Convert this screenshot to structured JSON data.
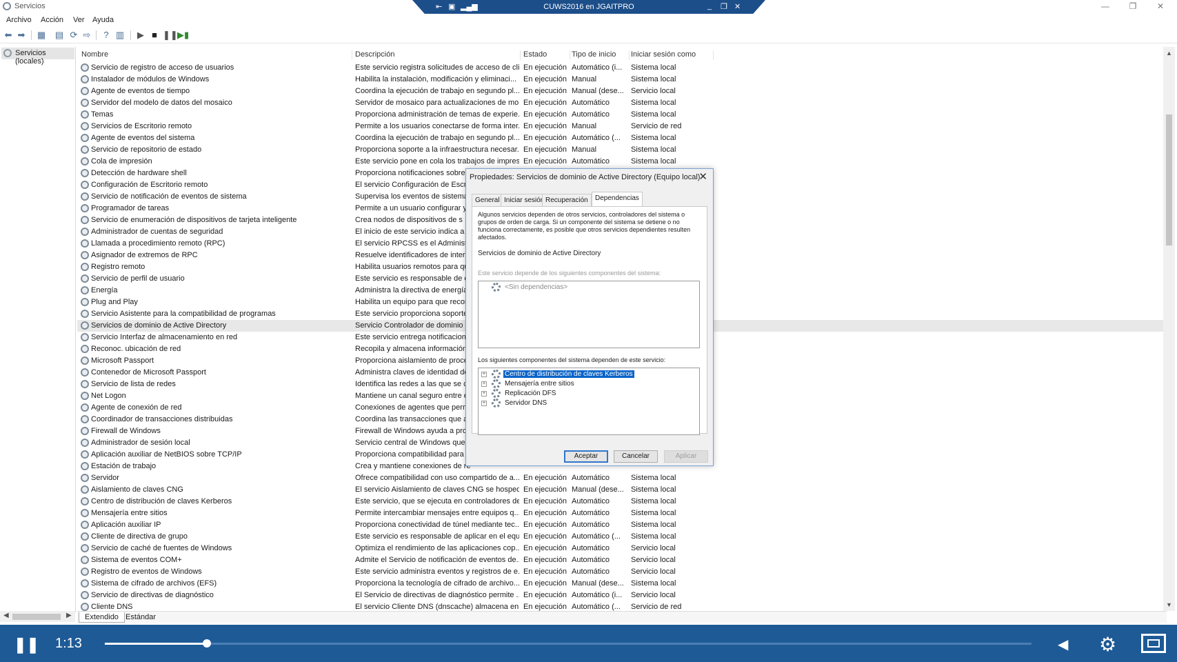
{
  "window": {
    "title": "Servicios"
  },
  "remote": {
    "title": "CUWS2016 en JGAITPRO"
  },
  "menu": [
    "Archivo",
    "Acción",
    "Ver",
    "Ayuda"
  ],
  "tree": {
    "root_label": "Servicios (locales)"
  },
  "columns": {
    "name": "Nombre",
    "description": "Descripción",
    "status": "Estado",
    "startup": "Tipo de inicio",
    "logon": "Iniciar sesión como"
  },
  "services": [
    {
      "name": "Servicio de registro de acceso de usuarios",
      "desc": "Este servicio registra solicitudes de acceso de cli...",
      "status": "En ejecución",
      "startup": "Automático (i...",
      "logon": "Sistema local"
    },
    {
      "name": "Instalador de módulos de Windows",
      "desc": "Habilita la instalación, modificación y eliminaci...",
      "status": "En ejecución",
      "startup": "Manual",
      "logon": "Sistema local"
    },
    {
      "name": "Agente de eventos de tiempo",
      "desc": "Coordina la ejecución de trabajo en segundo pl...",
      "status": "En ejecución",
      "startup": "Manual (dese...",
      "logon": "Servicio local"
    },
    {
      "name": "Servidor del modelo de datos del mosaico",
      "desc": "Servidor de mosaico para actualizaciones de mo...",
      "status": "En ejecución",
      "startup": "Automático",
      "logon": "Sistema local"
    },
    {
      "name": "Temas",
      "desc": "Proporciona administración de temas de experie...",
      "status": "En ejecución",
      "startup": "Automático",
      "logon": "Sistema local"
    },
    {
      "name": "Servicios de Escritorio remoto",
      "desc": "Permite a los usuarios conectarse de forma inter...",
      "status": "En ejecución",
      "startup": "Manual",
      "logon": "Servicio de red"
    },
    {
      "name": "Agente de eventos del sistema",
      "desc": "Coordina la ejecución de trabajo en segundo pl...",
      "status": "En ejecución",
      "startup": "Automático (...",
      "logon": "Sistema local"
    },
    {
      "name": "Servicio de repositorio de estado",
      "desc": "Proporciona soporte a la infraestructura necesar...",
      "status": "En ejecución",
      "startup": "Manual",
      "logon": "Sistema local"
    },
    {
      "name": "Cola de impresión",
      "desc": "Este servicio pone en cola los trabajos de impres...",
      "status": "En ejecución",
      "startup": "Automático",
      "logon": "Sistema local"
    },
    {
      "name": "Detección de hardware shell",
      "desc": "Proporciona notificaciones sobre",
      "status": "",
      "startup": "",
      "logon": ""
    },
    {
      "name": "Configuración de Escritorio remoto",
      "desc": "El servicio Configuración de Escrit",
      "status": "",
      "startup": "",
      "logon": ""
    },
    {
      "name": "Servicio de notificación de eventos de sistema",
      "desc": "Supervisa los eventos de sistema y",
      "status": "",
      "startup": "",
      "logon": ""
    },
    {
      "name": "Programador de tareas",
      "desc": "Permite a un usuario configurar y",
      "status": "",
      "startup": "",
      "logon": ""
    },
    {
      "name": "Servicio de enumeración de dispositivos de tarjeta inteligente",
      "desc": "Crea nodos de dispositivos de s",
      "status": "",
      "startup": "",
      "logon": ""
    },
    {
      "name": "Administrador de cuentas de seguridad",
      "desc": "El inicio de este servicio indica a",
      "status": "",
      "startup": "",
      "logon": ""
    },
    {
      "name": "Llamada a procedimiento remoto (RPC)",
      "desc": "El servicio RPCSS es el Administra",
      "status": "",
      "startup": "",
      "logon": ""
    },
    {
      "name": "Asignador de extremos de RPC",
      "desc": "Resuelve identificadores de interfa",
      "status": "",
      "startup": "",
      "logon": ""
    },
    {
      "name": "Registro remoto",
      "desc": "Habilita usuarios remotos para qu",
      "status": "",
      "startup": "",
      "logon": ""
    },
    {
      "name": "Servicio de perfil de usuario",
      "desc": "Este servicio es responsable de ca",
      "status": "",
      "startup": "",
      "logon": ""
    },
    {
      "name": "Energía",
      "desc": "Administra la directiva de energía",
      "status": "",
      "startup": "",
      "logon": ""
    },
    {
      "name": "Plug and Play",
      "desc": "Habilita un equipo para que recor",
      "status": "",
      "startup": "",
      "logon": ""
    },
    {
      "name": "Servicio Asistente para la compatibilidad de programas",
      "desc": "Este servicio proporciona soporte",
      "status": "",
      "startup": "",
      "logon": ""
    },
    {
      "name": "Servicios de dominio de Active Directory",
      "desc": "Servicio Controlador de dominio",
      "status": "",
      "startup": "",
      "logon": ""
    },
    {
      "name": "Servicio Interfaz de almacenamiento en red",
      "desc": "Este servicio entrega notificacione",
      "status": "",
      "startup": "",
      "logon": ""
    },
    {
      "name": "Reconoc. ubicación de red",
      "desc": "Recopila y almacena información",
      "status": "",
      "startup": "",
      "logon": ""
    },
    {
      "name": "Microsoft Passport",
      "desc": "Proporciona aislamiento de proce",
      "status": "",
      "startup": "",
      "logon": ""
    },
    {
      "name": "Contenedor de Microsoft Passport",
      "desc": "Administra claves de identidad de",
      "status": "",
      "startup": "",
      "logon": ""
    },
    {
      "name": "Servicio de lista de redes",
      "desc": "Identifica las redes a las que se co",
      "status": "",
      "startup": "",
      "logon": ""
    },
    {
      "name": "Net Logon",
      "desc": "Mantiene un canal seguro entre el",
      "status": "",
      "startup": "",
      "logon": ""
    },
    {
      "name": "Agente de conexión de red",
      "desc": "Conexiones de agentes que perm",
      "status": "",
      "startup": "",
      "logon": ""
    },
    {
      "name": "Coordinador de transacciones distribuidas",
      "desc": "Coordina las transacciones que ab",
      "status": "",
      "startup": "",
      "logon": ""
    },
    {
      "name": "Firewall de Windows",
      "desc": "Firewall de Windows ayuda a prot",
      "status": "",
      "startup": "",
      "logon": ""
    },
    {
      "name": "Administrador de sesión local",
      "desc": "Servicio central de Windows que a",
      "status": "",
      "startup": "",
      "logon": ""
    },
    {
      "name": "Aplicación auxiliar de NetBIOS sobre TCP/IP",
      "desc": "Proporciona compatibilidad para",
      "status": "",
      "startup": "",
      "logon": ""
    },
    {
      "name": "Estación de trabajo",
      "desc": "Crea y mantiene conexiones de re",
      "status": "",
      "startup": "",
      "logon": ""
    },
    {
      "name": "Servidor",
      "desc": "Ofrece compatibilidad con uso compartido de a...",
      "status": "En ejecución",
      "startup": "Automático",
      "logon": "Sistema local"
    },
    {
      "name": "Aislamiento de claves CNG",
      "desc": "El servicio Aislamiento de claves CNG se hosped...",
      "status": "En ejecución",
      "startup": "Manual (dese...",
      "logon": "Sistema local"
    },
    {
      "name": "Centro de distribución de claves Kerberos",
      "desc": "Este servicio, que se ejecuta en controladores de...",
      "status": "En ejecución",
      "startup": "Automático",
      "logon": "Sistema local"
    },
    {
      "name": "Mensajería entre sitios",
      "desc": "Permite intercambiar mensajes entre equipos q...",
      "status": "En ejecución",
      "startup": "Automático",
      "logon": "Sistema local"
    },
    {
      "name": "Aplicación auxiliar IP",
      "desc": "Proporciona conectividad de túnel mediante tec...",
      "status": "En ejecución",
      "startup": "Automático",
      "logon": "Sistema local"
    },
    {
      "name": "Cliente de directiva de grupo",
      "desc": "Este servicio es responsable de aplicar en el equi...",
      "status": "En ejecución",
      "startup": "Automático (...",
      "logon": "Sistema local"
    },
    {
      "name": "Servicio de caché de fuentes de Windows",
      "desc": "Optimiza el rendimiento de las aplicaciones cop...",
      "status": "En ejecución",
      "startup": "Automático",
      "logon": "Servicio local"
    },
    {
      "name": "Sistema de eventos COM+",
      "desc": "Admite el Servicio de notificación de eventos de...",
      "status": "En ejecución",
      "startup": "Automático",
      "logon": "Servicio local"
    },
    {
      "name": "Registro de eventos de Windows",
      "desc": "Este servicio administra eventos y registros de e...",
      "status": "En ejecución",
      "startup": "Automático",
      "logon": "Servicio local"
    },
    {
      "name": "Sistema de cifrado de archivos (EFS)",
      "desc": "Proporciona la tecnología de cifrado de archivo...",
      "status": "En ejecución",
      "startup": "Manual (dese...",
      "logon": "Sistema local"
    },
    {
      "name": "Servicio de directivas de diagnóstico",
      "desc": "El Servicio de directivas de diagnóstico permite ...",
      "status": "En ejecución",
      "startup": "Automático (i...",
      "logon": "Servicio local"
    },
    {
      "name": "Cliente DNS",
      "desc": "El servicio Cliente DNS (dnscache) almacena en ...",
      "status": "En ejecución",
      "startup": "Automático (...",
      "logon": "Servicio de red"
    }
  ],
  "bottom_tabs": [
    "Extendido",
    "Estándar"
  ],
  "dialog": {
    "title": "Propiedades: Servicios de dominio de Active Directory (Equipo local)",
    "tabs": [
      "General",
      "Iniciar sesión",
      "Recuperación",
      "Dependencias"
    ],
    "info": "Algunos servicios dependen de otros servicios, controladores del sistema o grupos de orden de carga. Si un componente del sistema se detiene o no funciona correctamente, es posible que otros servicios dependientes resulten afectados.",
    "service_name": "Servicios de dominio de Active Directory",
    "depends_label": "Este servicio depende de los siguientes componentes del sistema:",
    "depends_items": [
      "<Sin dependencias>"
    ],
    "dependents_label": "Los siguientes componentes del sistema dependen de este servicio:",
    "dependents_items": [
      "Centro de distribución de claves Kerberos",
      "Mensajería entre sitios",
      "Replicación DFS",
      "Servidor DNS"
    ],
    "buttons": {
      "ok": "Aceptar",
      "cancel": "Cancelar",
      "apply": "Aplicar"
    }
  },
  "player": {
    "time": "1:13",
    "progress_fraction": 0.11
  }
}
